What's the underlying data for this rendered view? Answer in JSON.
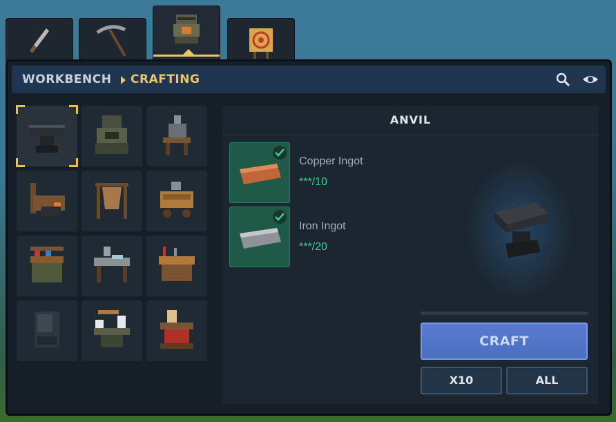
{
  "tabs": [
    {
      "icon": "knife-icon",
      "active": false
    },
    {
      "icon": "pickaxe-icon",
      "active": false
    },
    {
      "icon": "workbench-icon",
      "active": true
    },
    {
      "icon": "target-icon",
      "active": false
    }
  ],
  "header": {
    "crumb_root": "WORKBENCH",
    "crumb_current": "CRAFTING",
    "search_icon": "search-icon",
    "view_icon": "eye-icon"
  },
  "recipes": [
    {
      "icon": "anvil-icon",
      "selected": true
    },
    {
      "icon": "furnace-icon",
      "selected": false
    },
    {
      "icon": "armor-stand-icon",
      "selected": false
    },
    {
      "icon": "smithing-station-icon",
      "selected": false
    },
    {
      "icon": "tanning-rack-icon",
      "selected": false
    },
    {
      "icon": "tool-bench-icon",
      "selected": false
    },
    {
      "icon": "alchemy-table-icon",
      "selected": false
    },
    {
      "icon": "tailoring-table-icon",
      "selected": false
    },
    {
      "icon": "carpentry-bench-icon",
      "selected": false
    },
    {
      "icon": "locker-icon",
      "selected": false
    },
    {
      "icon": "potion-table-icon",
      "selected": false
    },
    {
      "icon": "cooking-station-icon",
      "selected": false
    }
  ],
  "detail": {
    "title": "ANVIL",
    "ingredients": [
      {
        "name": "Copper Ingot",
        "qty": "***/10",
        "icon": "copper-ingot-icon",
        "ready": true
      },
      {
        "name": "Iron Ingot",
        "qty": "***/20",
        "icon": "iron-ingot-icon",
        "ready": true
      }
    ],
    "preview_icon": "anvil-icon",
    "progress": 0,
    "craft_label": "CRAFT",
    "x10_label": "X10",
    "all_label": "ALL"
  },
  "colors": {
    "accent": "#e9c46a",
    "ready_green": "#3ecf8e",
    "craft_blue": "#4a6fc0"
  }
}
